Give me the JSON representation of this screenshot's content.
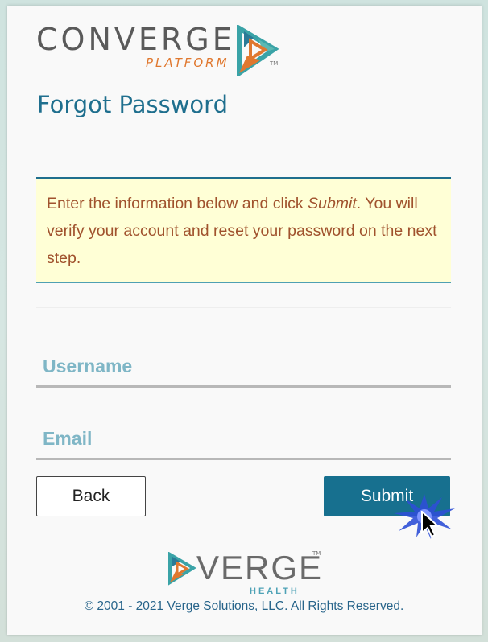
{
  "brand": {
    "logo_word": "CONVERGE",
    "logo_sub": "PLATFORM",
    "logo_tm": "TM"
  },
  "page": {
    "title": "Forgot Password"
  },
  "info": {
    "text_before": "Enter the information below and click ",
    "text_emphasis": "Submit",
    "text_after": ". You will verify your account and reset your password on the next step."
  },
  "form": {
    "username_label": "Username",
    "email_label": "Email",
    "username_value": "",
    "email_value": ""
  },
  "buttons": {
    "back_label": "Back",
    "submit_label": "Submit"
  },
  "footer": {
    "verge_word": "VERGE",
    "verge_health": "HEALTH",
    "verge_tm": "TM",
    "copyright": "© 2001 - 2021 Verge Solutions, LLC. All Rights Reserved."
  },
  "colors": {
    "accent": "#17708f",
    "title": "#1f6f8e",
    "info_bg": "#ffffd6",
    "info_text": "#a0522d",
    "label": "#7fb6c6",
    "brand_orange": "#e0782f"
  }
}
